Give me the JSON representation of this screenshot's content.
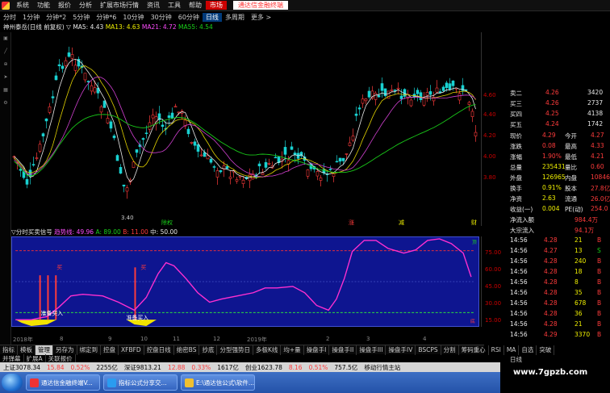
{
  "menubar": {
    "items": [
      "系统",
      "功能",
      "报价",
      "分析",
      "扩展市场行情",
      "资讯",
      "工具",
      "帮助"
    ],
    "active_item": "市场",
    "ad_text": "通达信金融终端"
  },
  "timeframes": {
    "items": [
      "分时",
      "1分钟",
      "分钟*2",
      "5分钟",
      "分钟*6",
      "10分钟",
      "30分钟",
      "60分钟",
      "日线",
      "多周期",
      "更多 >"
    ],
    "active": "日线"
  },
  "stock_header": {
    "name": "神州泰岳(日线 前复权)",
    "ma5": "MA5: 4.43",
    "ma13": "MA13: 4.63",
    "ma21": "MA21: 4.72",
    "ma55": "MA55: 4.54"
  },
  "main_chart": {
    "price_labels": [
      "4.60",
      "4.40",
      "4.20",
      "4.00",
      "3.80"
    ],
    "low_marker": "3.40",
    "event_markers": [
      "除权",
      "涨",
      "减",
      "财"
    ]
  },
  "oscillator": {
    "header": "▽分时买卖信号",
    "line1": "趋势线: 49.96",
    "line2": "A: 89.00",
    "line3": "B: 11.00",
    "line4": "中: 50.00",
    "axis_labels": [
      "75.00",
      "60.00",
      "45.00",
      "30.00",
      "15.00"
    ],
    "signal_text_1": "准备买入",
    "signal_text_2": "准备买入",
    "buy_label": "买",
    "sell_label": "卖",
    "top_label": "顶",
    "bottom_label": "底"
  },
  "dates": [
    "2018年",
    "8",
    "9",
    "10",
    "11",
    "12",
    "2019年",
    "2",
    "3",
    "4"
  ],
  "tabs_row1": [
    "指标",
    "模板",
    "管理",
    "另存为",
    "绑定到",
    "控盘",
    "XFBFD",
    "控盘日线",
    "绝密BS",
    "抄底",
    "分型强势日",
    "多极K线",
    "均+量",
    "操盘手I",
    "操盘手II",
    "操盘手III",
    "操盘手IV",
    "BSCPS",
    "分割",
    "筹码重心",
    "RSI",
    "MA",
    "自选",
    "突破"
  ],
  "tabs_row2": [
    "并弹幕",
    "扩展A",
    "关联报价"
  ],
  "tab_active": "管理",
  "statusbar": {
    "sh": "上证3078.34",
    "sh_chg": "15.84",
    "sh_pct": "0.52%",
    "sh_amt": "2255亿",
    "sz": "深证9813.21",
    "sz_chg": "12.88",
    "sz_pct": "0.33%",
    "sz_amt": "1617亿",
    "cy": "创业1623.78",
    "cy_chg": "8.16",
    "cy_pct": "0.51%",
    "cy_amt": "757.5亿",
    "mobile": "移动行情主站"
  },
  "taskbar": {
    "tasks": [
      "通达信金融终端V...",
      "指标公式分享交...",
      "E:\\通达信公式\\软件..."
    ]
  },
  "quote": {
    "asks": [
      {
        "label": "卖二",
        "price": "4.26",
        "vol": "3420"
      },
      {
        "label": "买三",
        "price": "4.26",
        "vol": "2737"
      },
      {
        "label": "买四",
        "price": "4.25",
        "vol": "4138"
      },
      {
        "label": "买五",
        "price": "4.24",
        "vol": "1742"
      }
    ],
    "stats": [
      {
        "l1": "现价",
        "v1": "4.29",
        "l2": "今开",
        "v2": "4.27"
      },
      {
        "l1": "涨跌",
        "v1": "0.08",
        "l2": "最高",
        "v2": "4.33"
      },
      {
        "l1": "涨幅",
        "v1": "1.90%",
        "l2": "最低",
        "v2": "4.21"
      },
      {
        "l1": "总量",
        "v1": "235431",
        "l2": "量比",
        "v2": "0.60"
      },
      {
        "l1": "外盘",
        "v1": "126965",
        "l2": "内盘",
        "v2": "108466"
      },
      {
        "l1": "换手",
        "v1": "0.91%",
        "l2": "股本",
        "v2": "27.8亿"
      },
      {
        "l1": "净资",
        "v1": "2.63",
        "l2": "流通",
        "v2": "26.0亿"
      },
      {
        "l1": "收益(一)",
        "v1": "0.004",
        "l2": "PE(动)",
        "v2": "254.0"
      }
    ],
    "flow": [
      {
        "label": "净流入额",
        "value": "984.4万"
      },
      {
        "label": "大宗流入",
        "value": "94.1万"
      }
    ],
    "ticks": [
      {
        "time": "14:56",
        "price": "4.28",
        "vol": "21",
        "bs": "B"
      },
      {
        "time": "14:56",
        "price": "4.27",
        "vol": "13",
        "bs": "S"
      },
      {
        "time": "14:56",
        "price": "4.28",
        "vol": "240",
        "bs": "B"
      },
      {
        "time": "14:56",
        "price": "4.28",
        "vol": "18",
        "bs": "B"
      },
      {
        "time": "14:56",
        "price": "4.28",
        "vol": "8",
        "bs": "B"
      },
      {
        "time": "14:56",
        "price": "4.28",
        "vol": "35",
        "bs": "B"
      },
      {
        "time": "14:56",
        "price": "4.28",
        "vol": "678",
        "bs": "B"
      },
      {
        "time": "14:56",
        "price": "4.28",
        "vol": "36",
        "bs": "B"
      },
      {
        "time": "14:56",
        "price": "4.28",
        "vol": "21",
        "bs": "B"
      },
      {
        "time": "14:56",
        "price": "4.29",
        "vol": "3370",
        "bs": "B"
      }
    ],
    "footer_tab": "日线"
  },
  "watermark": "www.7gpzb.com",
  "colors": {
    "up": "#ff3b3b",
    "down": "#19d219",
    "osc_bg": "#0e1590",
    "osc_line": "#ff2fd0",
    "signal_bar": "#f2e300"
  }
}
